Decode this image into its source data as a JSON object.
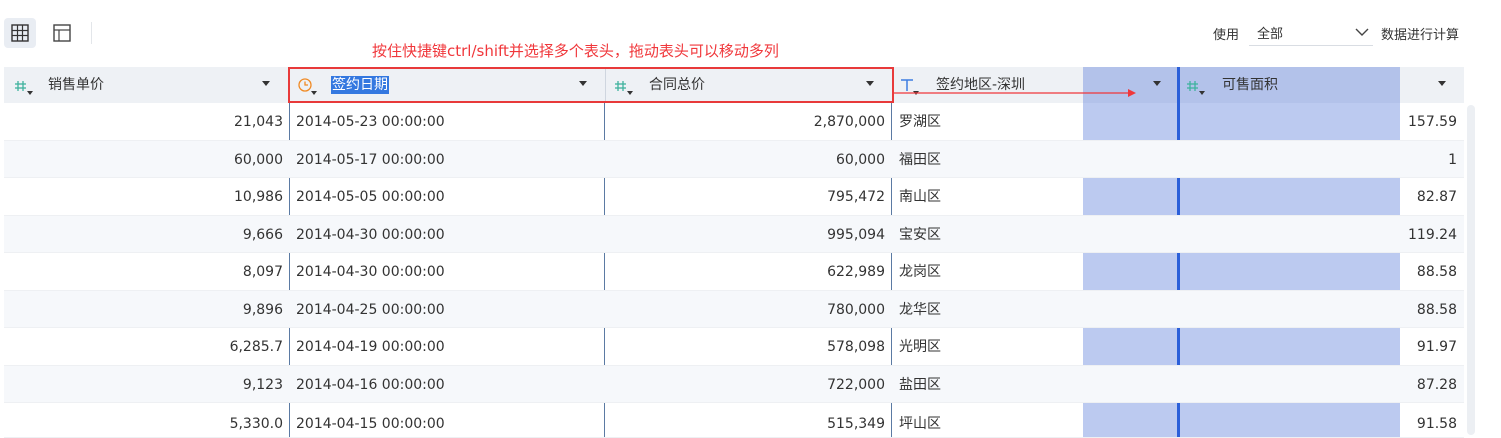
{
  "toolbar": {
    "use_label": "使用",
    "scope_value": "全部",
    "calc_label": "数据进行计算",
    "annotation": "按住快捷键ctrl/shift并选择多个表头，拖动表头可以移动多列"
  },
  "columns": [
    {
      "label": "销售单价",
      "type": "number"
    },
    {
      "label": "签约日期",
      "type": "date"
    },
    {
      "label": "合同总价",
      "type": "number"
    },
    {
      "label": "签约地区-深圳",
      "type": "text"
    },
    {
      "label": "可售面积",
      "type": "number"
    }
  ],
  "rows": [
    {
      "price": "21,043",
      "date": "2014-05-23 00:00:00",
      "total": "2,870,000",
      "region": "罗湖区",
      "area": "157.59"
    },
    {
      "price": "60,000",
      "date": "2014-05-17 00:00:00",
      "total": "60,000",
      "region": "福田区",
      "area": "1"
    },
    {
      "price": "10,986",
      "date": "2014-05-05 00:00:00",
      "total": "795,472",
      "region": "南山区",
      "area": "82.87"
    },
    {
      "price": "9,666",
      "date": "2014-04-30 00:00:00",
      "total": "995,094",
      "region": "宝安区",
      "area": "119.24"
    },
    {
      "price": "8,097",
      "date": "2014-04-30 00:00:00",
      "total": "622,989",
      "region": "龙岗区",
      "area": "88.58"
    },
    {
      "price": "9,896",
      "date": "2014-04-25 00:00:00",
      "total": "780,000",
      "region": "龙华区",
      "area": "88.58"
    },
    {
      "price": "6,285.7",
      "date": "2014-04-19 00:00:00",
      "total": "578,098",
      "region": "光明区",
      "area": "91.97"
    },
    {
      "price": "9,123",
      "date": "2014-04-16 00:00:00",
      "total": "722,000",
      "region": "盐田区",
      "area": "87.28"
    }
  ],
  "colors": {
    "accent": "#2b5fd9",
    "annotation": "#f0373b",
    "number_icon": "#3fb39e",
    "date_icon": "#f08a24",
    "text_icon": "#3d7de0",
    "highlight": "#6a8ade"
  }
}
